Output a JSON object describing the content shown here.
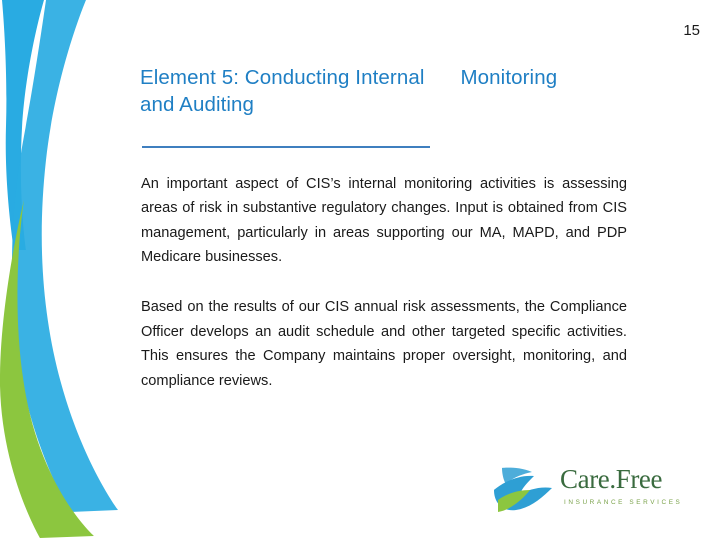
{
  "slide": {
    "number": "15",
    "title_line1_a": "Element 5: Conducting Internal",
    "title_line1_b": "Monitoring",
    "title_line2": "and Auditing",
    "paragraphs": [
      "An important aspect of CIS’s internal monitoring activities is assessing areas of risk in substantive regulatory changes. Input is obtained from CIS management, particularly in areas supporting our MA, MAPD, and PDP Medicare businesses.",
      "Based on the results of our CIS annual risk assessments, the Compliance Officer develops an audit schedule and other targeted specific activities. This ensures the Company maintains proper oversight, monitoring, and compliance reviews."
    ],
    "logo": {
      "name": "Care.Free",
      "tagline": "INSURANCE SERVICES"
    },
    "colors": {
      "title_blue": "#1f7fc4",
      "rule_blue": "#3f7fbf",
      "swoosh_blue": "#29abe2",
      "swoosh_green": "#8cc63f",
      "logo_green": "#3a6b3f"
    }
  }
}
